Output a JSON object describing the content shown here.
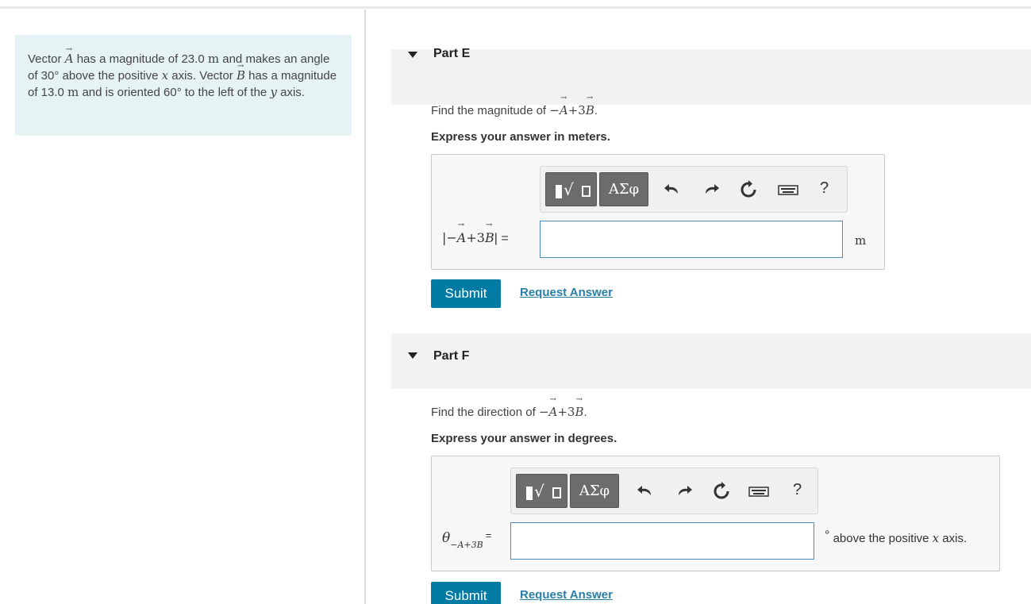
{
  "intro": {
    "t1": "Vector ",
    "vecA": "A",
    "t2": " has a magnitude of 23.0 ",
    "unit_m": "m",
    "t3": " and makes an angle of 30° above the positive ",
    "x": "x",
    "t4": " axis. Vector ",
    "vecB": "B",
    "t5": " has a magnitude of 13.0 ",
    "t6": " and is oriented 60° to the left of the ",
    "y": "y",
    "t7": " axis."
  },
  "part_e": {
    "title": "Part E",
    "prompt_prefix": "Find the magnitude of ",
    "prompt_expr_pre": "−",
    "prompt_vecA": "A",
    "prompt_expr_mid": "+3",
    "prompt_vecB": "B",
    "prompt_end": ".",
    "express": "Express your answer in meters.",
    "label_pre": "|−",
    "label_vecA": "A",
    "label_mid": "+3",
    "label_vecB": "B",
    "label_post": "| =",
    "input_value": "",
    "unit": "m",
    "submit": "Submit",
    "request": "Request Answer"
  },
  "part_f": {
    "title": "Part F",
    "prompt_prefix": "Find the direction of ",
    "prompt_expr_pre": "−",
    "prompt_vecA": "A",
    "prompt_expr_mid": "+3",
    "prompt_vecB": "B",
    "prompt_end": ".",
    "express": "Express your answer in degrees.",
    "label_theta": "θ",
    "label_sub": "−A+3B",
    "label_eq": "=",
    "input_value": "",
    "unit_deg": "°",
    "unit_text_pre": "above the positive ",
    "unit_x": "x",
    "unit_text_post": " axis.",
    "submit": "Submit",
    "request": "Request Answer"
  },
  "toolbar": {
    "symbols_label": "ΑΣφ",
    "help_label": "?",
    "icons": [
      "templates-icon",
      "symbols-icon",
      "undo-icon",
      "redo-icon",
      "reset-icon",
      "keyboard-icon",
      "help-icon"
    ]
  }
}
